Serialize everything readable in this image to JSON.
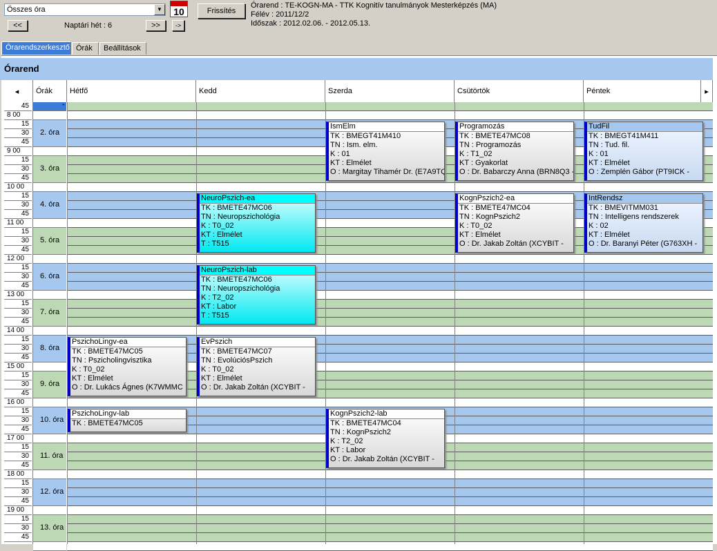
{
  "toolbar": {
    "combo_value": "Összes óra",
    "calendar_day": "10",
    "prev_label": "<<",
    "next_label": ">>",
    "go_label": "->",
    "week_label": "Naptári hét : 6",
    "refresh_label": "Frissítés"
  },
  "info": {
    "line1": "Órarend : TE-KOGN-MA - TTK Kognitív tanulmányok Mesterképzés (MA)",
    "line2": "Félév : 2011/12/2",
    "line3": "Időszak : 2012.02.06. - 2012.05.13."
  },
  "tabs": [
    "Órarendszerkesztő",
    "Órák",
    "Beállítások"
  ],
  "title": "Órarend",
  "header": {
    "left_arrow": "◂",
    "orak": "Órák",
    "days": [
      "Hétfő",
      "Kedd",
      "Szerda",
      "Csütörtök",
      "Péntek"
    ],
    "right_arrow": "▸"
  },
  "hours": [
    "8 00",
    "9 00",
    "10 00",
    "11 00",
    "12 00",
    "13 00",
    "14 00",
    "15 00",
    "16 00",
    "17 00",
    "18 00",
    "19 00"
  ],
  "minutes": [
    "15",
    "30",
    "45"
  ],
  "first_min": "45",
  "lessons": [
    "2. óra",
    "3. óra",
    "4. óra",
    "5. óra",
    "6. óra",
    "7. óra",
    "8. óra",
    "9. óra",
    "10. óra",
    "11. óra",
    "12. óra",
    "13. óra"
  ],
  "events": [
    {
      "title": "IsmElm",
      "lines": [
        "TK : BMEGT41M410",
        "TN : Ism. elm.",
        "K : 01",
        "KT : Elmélet",
        "O :  Margitay Tihamér Dr. (E7A9TQ"
      ]
    },
    {
      "title": "Programozás",
      "lines": [
        "TK : BMETE47MC08",
        "TN : Programozás",
        "K : T1_02",
        "KT : Gyakorlat",
        "O :  Dr. Babarczy Anna (BRN8Q3 -"
      ]
    },
    {
      "title": "TudFil",
      "lines": [
        "TK : BMEGT41M411",
        "TN : Tud. fil.",
        "K : 01",
        "KT : Elmélet",
        "O :  Zemplén Gábor (PT9ICK -"
      ]
    },
    {
      "title": "NeuroPszich-ea",
      "lines": [
        "TK : BMETE47MC06",
        "TN : Neuropszichológia",
        "K : T0_02",
        "KT : Elmélet",
        "T : T515"
      ]
    },
    {
      "title": "KognPszich2-ea",
      "lines": [
        "TK : BMETE47MC04",
        "TN : KognPszich2",
        "K : T0_02",
        "KT : Elmélet",
        "O :  Dr. Jakab Zoltán (XCYBIT -"
      ]
    },
    {
      "title": "IntRendsz",
      "lines": [
        "TK : BMEVITMM031",
        "TN : Intelligens rendszerek",
        "K : 02",
        "KT : Elmélet",
        "O :  Dr. Baranyi Péter (G763XH -"
      ]
    },
    {
      "title": "NeuroPszich-lab",
      "lines": [
        "TK : BMETE47MC06",
        "TN : Neuropszichológia",
        "K : T2_02",
        "KT : Labor",
        "T : T515"
      ]
    },
    {
      "title": "PszichoLingv-ea",
      "lines": [
        "TK : BMETE47MC05",
        "TN : Pszicholingvisztika",
        "K : T0_02",
        "KT : Elmélet",
        "O :  Dr. Lukács Ágnes (K7WMMC"
      ]
    },
    {
      "title": "EvPszich",
      "lines": [
        "TK : BMETE47MC07",
        "TN : EvolúciósPszich",
        "K : T0_02",
        "KT : Elmélet",
        "O :  Dr. Jakab Zoltán (XCYBIT -"
      ]
    },
    {
      "title": "PszichoLingv-lab",
      "lines": [
        "TK : BMETE47MC05"
      ]
    },
    {
      "title": "KognPszich2-lab",
      "lines": [
        "TK : BMETE47MC04",
        "TN : KognPszich2",
        "K : T2_02",
        "KT : Labor",
        "O :  Dr. Jakab Zoltán (XCYBIT -"
      ]
    }
  ]
}
